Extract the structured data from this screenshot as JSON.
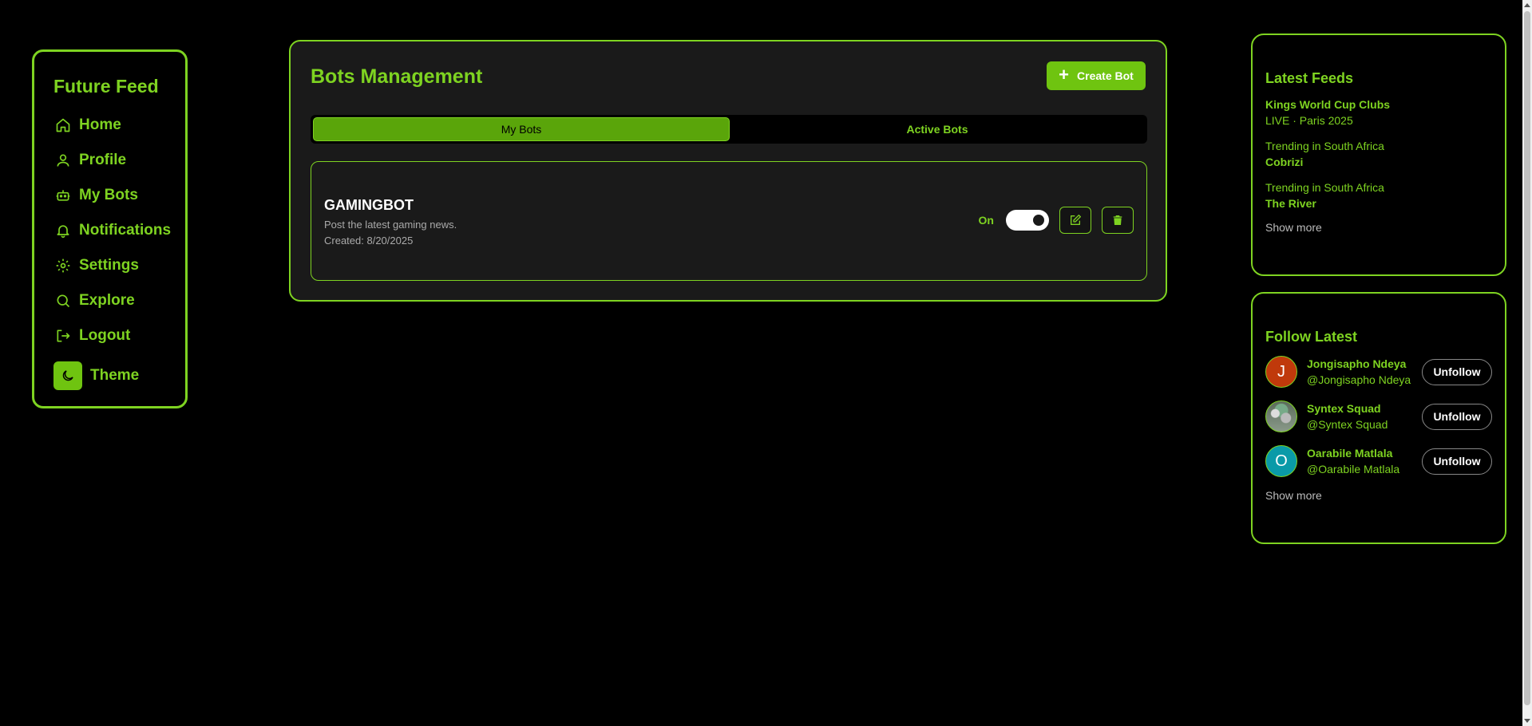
{
  "sidebar": {
    "brand": "Future Feed",
    "items": [
      {
        "label": "Home",
        "icon": "home-icon"
      },
      {
        "label": "Profile",
        "icon": "user-icon"
      },
      {
        "label": "My Bots",
        "icon": "bot-icon"
      },
      {
        "label": "Notifications",
        "icon": "bell-icon"
      },
      {
        "label": "Settings",
        "icon": "gear-icon"
      },
      {
        "label": "Explore",
        "icon": "search-icon"
      },
      {
        "label": "Logout",
        "icon": "logout-icon"
      }
    ],
    "theme": {
      "label": "Theme",
      "icon": "moon-icon"
    }
  },
  "main": {
    "title": "Bots Management",
    "create_button": {
      "label": "Create Bot",
      "icon": "plus-icon"
    },
    "tabs": [
      {
        "label": "My Bots",
        "active": true
      },
      {
        "label": "Active Bots",
        "active": false
      }
    ],
    "bots": [
      {
        "name": "GAMINGBOT",
        "description": "Post the latest gaming news.",
        "created": "Created: 8/20/2025",
        "status_label": "On",
        "enabled": true
      }
    ]
  },
  "latest_feeds": {
    "title": "Latest Feeds",
    "items": [
      {
        "line1": "Kings World Cup Clubs",
        "line2": "LIVE · Paris 2025"
      },
      {
        "line1": "Trending in South Africa",
        "line2": "Cobrizi"
      },
      {
        "line1": "Trending in South Africa",
        "line2": "The River"
      }
    ],
    "show_more": "Show more"
  },
  "follow_latest": {
    "title": "Follow Latest",
    "users": [
      {
        "initial": "J",
        "name": "Jongisapho Ndeya",
        "handle": "@Jongisapho Ndeya",
        "avatar_color": "#c0390b",
        "button": "Unfollow"
      },
      {
        "initial": "",
        "name": "Syntex Squad",
        "handle": "@Syntex Squad",
        "avatar_color": "photo",
        "button": "Unfollow"
      },
      {
        "initial": "O",
        "name": "Oarabile Matlala",
        "handle": "@Oarabile Matlala",
        "avatar_color": "#0a9aa8",
        "button": "Unfollow"
      }
    ],
    "show_more": "Show more"
  },
  "colors": {
    "accent": "#7ed321",
    "accent_fill": "#6fc410",
    "background": "#000000",
    "panel": "#1a1a1a"
  }
}
